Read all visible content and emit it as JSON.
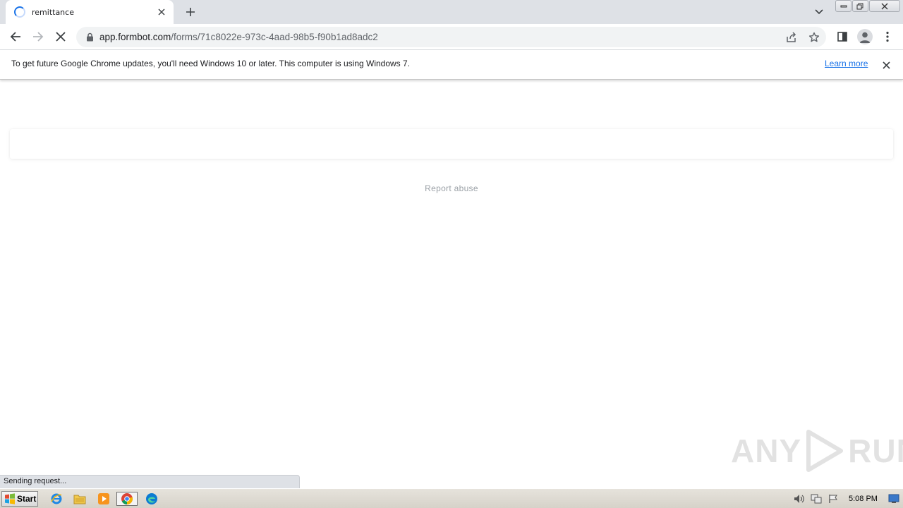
{
  "browser": {
    "tab": {
      "title": "remittance"
    },
    "url": {
      "host": "app.formbot.com",
      "path": "/forms/71c8022e-973c-4aad-98b5-f90b1ad8adc2"
    }
  },
  "infobar": {
    "message": "To get future Google Chrome updates, you'll need Windows 10 or later. This computer is using Windows 7.",
    "link_label": "Learn more"
  },
  "page": {
    "report_abuse": "Report abuse"
  },
  "status_bar": {
    "text": "Sending request..."
  },
  "watermark": {
    "left": "ANY",
    "right": "RUN"
  },
  "taskbar": {
    "start_label": "Start",
    "clock": "5:08 PM"
  },
  "colors": {
    "accent": "#1a73e8",
    "tabstrip": "#dee1e6",
    "omnibox": "#f1f3f4"
  }
}
